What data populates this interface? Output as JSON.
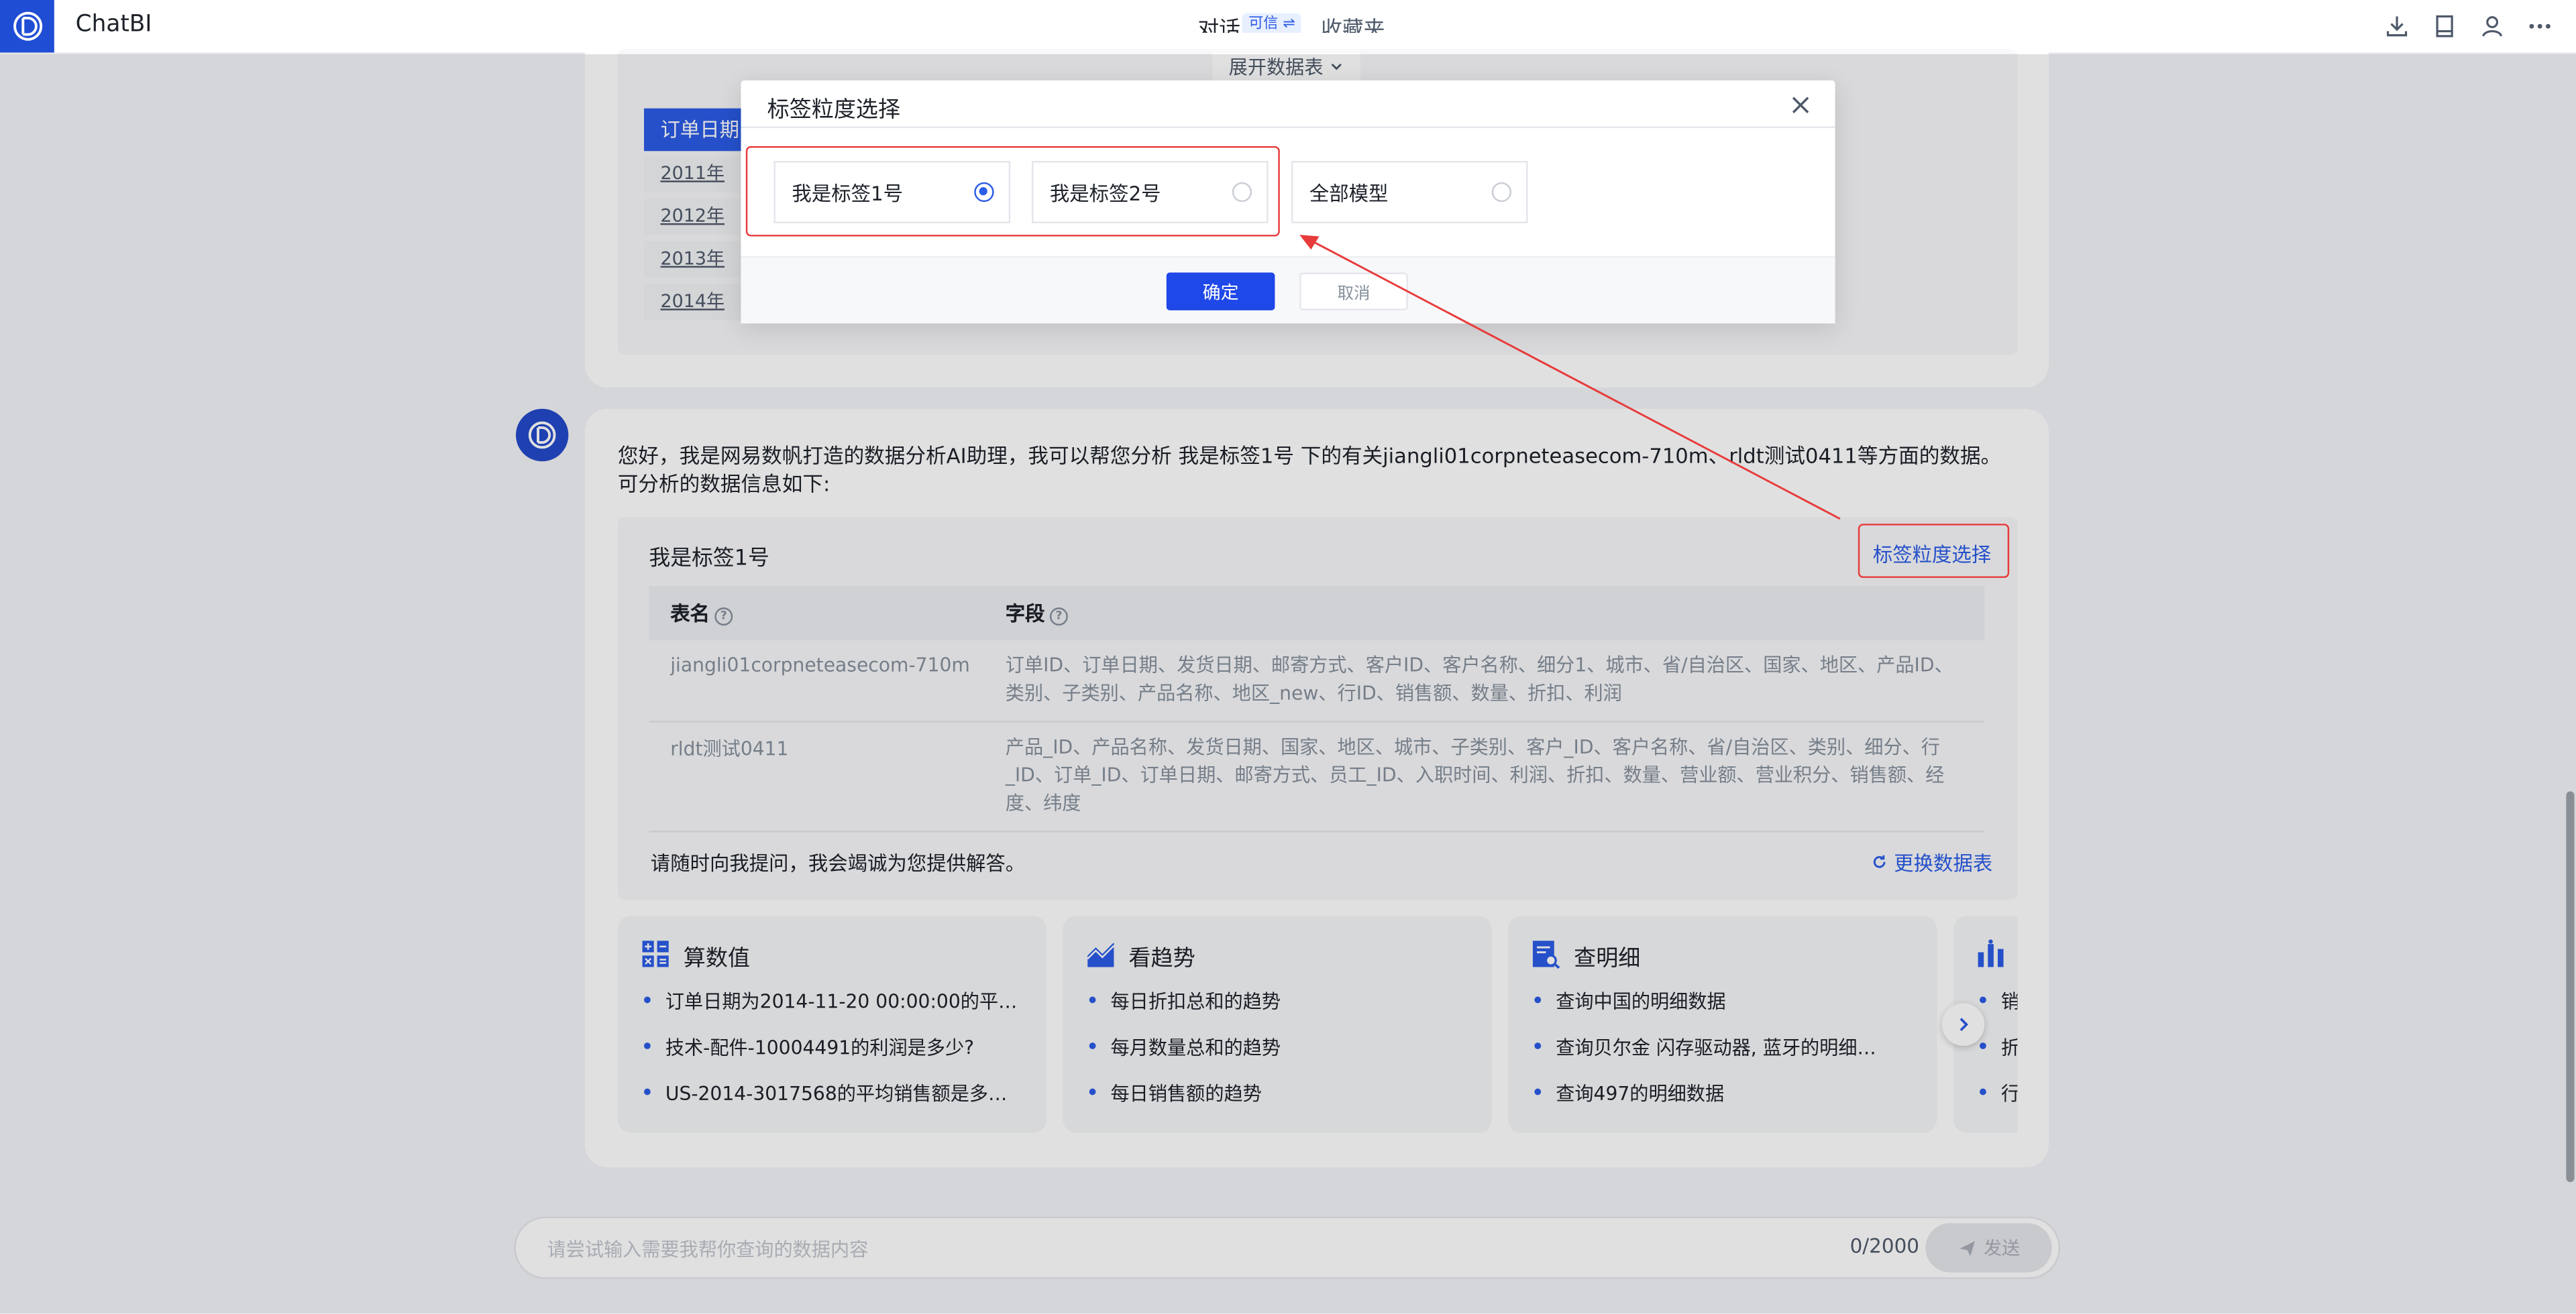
{
  "app": {
    "title": "ChatBI"
  },
  "nav": {
    "chat": "对话",
    "badge": "可信 ⇌",
    "favorites": "收藏夹"
  },
  "previous_answer": {
    "expand_label": "展开数据表",
    "table_header": "订单日期",
    "years": [
      "2011年",
      "2012年",
      "2013年",
      "2014年"
    ]
  },
  "message": {
    "intro": "您好，我是网易数帆打造的数据分析AI助理，我可以帮您分析 我是标签1号 下的有关jiangli01corpneteasecom-710m、rldt测试0411等方面的数据。可分析的数据信息如下:",
    "panel_title": "我是标签1号",
    "granularity_link": "标签粒度选择",
    "col_table": "表名",
    "col_fields": "字段",
    "rows": [
      {
        "table": "jiangli01corpneteasecom-710m",
        "fields": "订单ID、订单日期、发货日期、邮寄方式、客户ID、客户名称、细分1、城市、省/自治区、国家、地区、产品ID、类别、子类别、产品名称、地区_new、行ID、销售额、数量、折扣、利润"
      },
      {
        "table": "rldt测试0411",
        "fields": "产品_ID、产品名称、发货日期、国家、地区、城市、子类别、客户_ID、客户名称、省/自治区、类别、细分、行_ID、订单_ID、订单日期、邮寄方式、员工_ID、入职时间、利润、折扣、数量、营业额、营业积分、销售额、经度、纬度"
      }
    ],
    "footer_text": "请随时向我提问，我会竭诚为您提供解答。",
    "change_table": "更换数据表"
  },
  "suggestions": [
    {
      "title": "算数值",
      "icon": "calculator-icon",
      "items": [
        "订单日期为2014-11-20 00:00:00的平…",
        "技术-配件-10004491的利润是多少?",
        "US-2014-3017568的平均销售额是多…"
      ]
    },
    {
      "title": "看趋势",
      "icon": "trend-chart-icon",
      "items": [
        "每日折扣总和的趋势",
        "每月数量总和的趋势",
        "每日销售额的趋势"
      ]
    },
    {
      "title": "查明细",
      "icon": "detail-search-icon",
      "items": [
        "查询中国的明细数据",
        "查询贝尔金 闪存驱动器, 蓝牙的明细…",
        "查询497的明细数据"
      ]
    },
    {
      "title": "",
      "icon": "bar-chart-icon",
      "items": [
        "销",
        "折",
        "行"
      ]
    }
  ],
  "input": {
    "placeholder": "请尝试输入需要我帮你查询的数据内容",
    "counter": "0/2000",
    "send": "发送"
  },
  "modal": {
    "title": "标签粒度选择",
    "options": [
      {
        "label": "我是标签1号",
        "selected": true
      },
      {
        "label": "我是标签2号",
        "selected": false
      },
      {
        "label": "全部模型",
        "selected": false
      }
    ],
    "ok": "确定",
    "cancel": "取消"
  },
  "colors": {
    "primary": "#2b5ce6",
    "annotation": "#e83b3b"
  }
}
